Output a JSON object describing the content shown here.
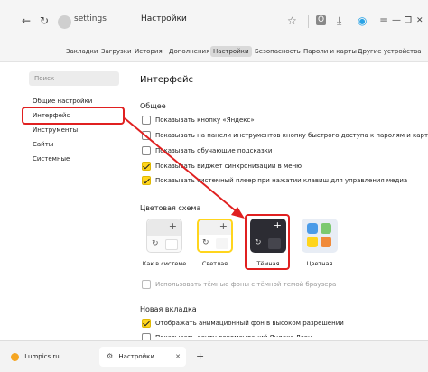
{
  "titlebar": {
    "back": "←",
    "reload": "↻",
    "address": "settings",
    "page_title": "Настройки",
    "window_controls": [
      "—",
      "❐",
      "✕"
    ]
  },
  "nav": {
    "items": [
      "Закладки",
      "Загрузки",
      "История",
      "Дополнения",
      "Настройки",
      "Безопасность",
      "Пароли и карты",
      "Другие устройства"
    ],
    "active_index": 4
  },
  "sidebar": {
    "search_placeholder": "Поиск",
    "items": [
      "Общие настройки",
      "Интерфейс",
      "Инструменты",
      "Сайты",
      "Системные"
    ]
  },
  "main": {
    "title": "Интерфейс",
    "section_general": "Общее",
    "options": [
      {
        "label": "Показывать кнопку «Яндекс»",
        "checked": false
      },
      {
        "label": "Показывать на панели инструментов кнопку быстрого доступа к паролям и карта",
        "checked": false
      },
      {
        "label": "Показывать обучающие подсказки",
        "checked": false
      },
      {
        "label": "Показывать виджет синхронизации в меню",
        "checked": true
      },
      {
        "label": "Показывать системный плеер при нажатии клавиш для управления медиа",
        "checked": true
      }
    ],
    "section_scheme": "Цветовая схема",
    "schemes": [
      "Как в системе",
      "Светлая",
      "Тёмная",
      "Цветная"
    ],
    "scheme_note": "Использовать тёмные фоны с тёмной темой браузера",
    "section_newtab": "Новая вкладка",
    "newtab_options": [
      {
        "label": "Отображать анимационный фон в высоком разрешении",
        "checked": true
      },
      {
        "label": "Показывать ленту рекомендаций Яндекс.Дзен",
        "checked": false
      }
    ]
  },
  "tabs": {
    "tab1": "Lumpics.ru",
    "tab2": "Настройки",
    "close": "✕",
    "new_tab": "+"
  },
  "colors": {
    "accent": "#ffd51d",
    "highlight": "#e02020"
  }
}
